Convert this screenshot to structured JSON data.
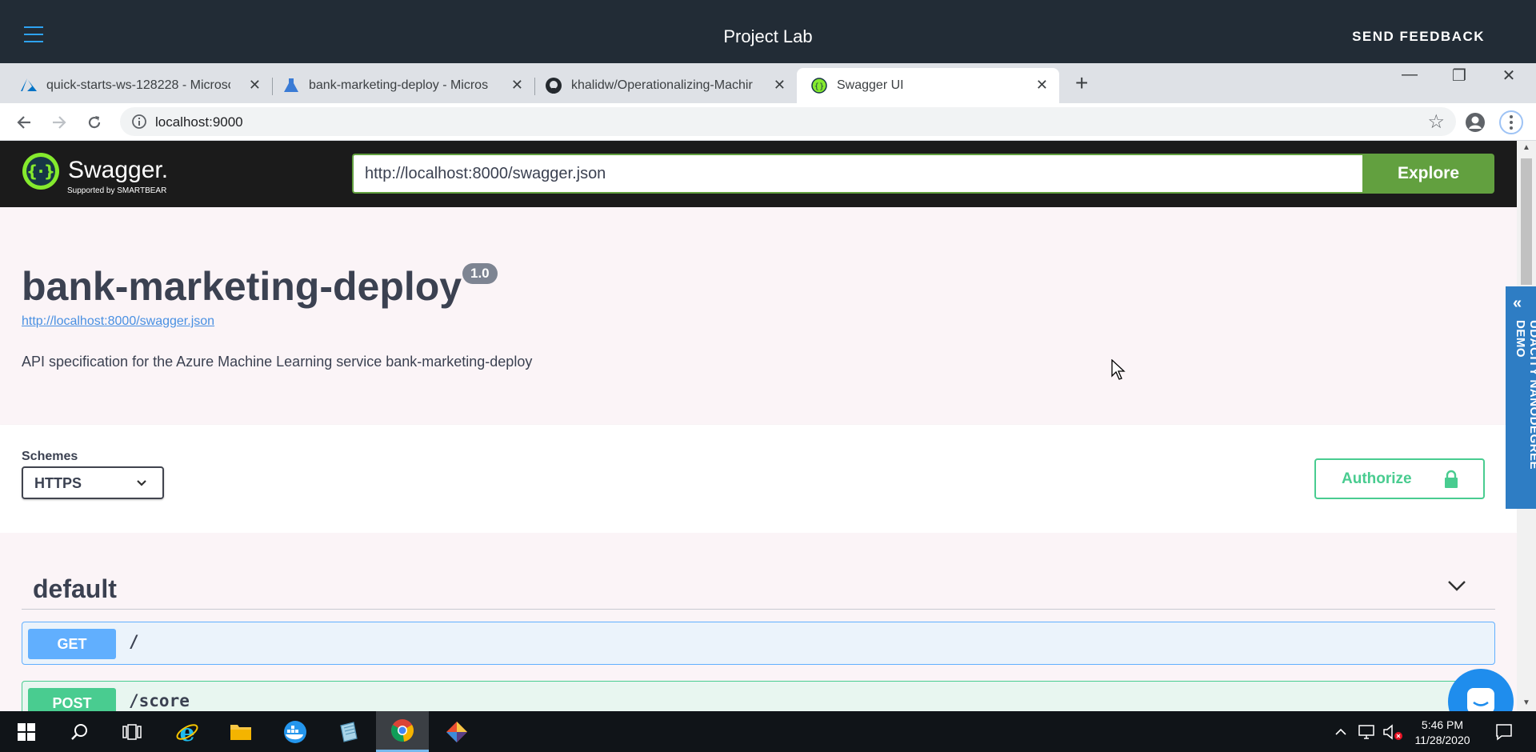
{
  "lab": {
    "title": "Project Lab",
    "feedback": "SEND FEEDBACK"
  },
  "browser": {
    "tabs": [
      {
        "title": "quick-starts-ws-128228 - Microso",
        "icon": "azure-icon"
      },
      {
        "title": "bank-marketing-deploy - Micros",
        "icon": "azure-ml-icon"
      },
      {
        "title": "khalidw/Operationalizing-Machir",
        "icon": "github-icon"
      },
      {
        "title": "Swagger UI",
        "icon": "swagger-icon"
      }
    ],
    "url": "localhost:9000"
  },
  "swagger": {
    "logo_text": "Swagger.",
    "logo_sub": "Supported by SMARTBEAR",
    "spec_url_value": "http://localhost:8000/swagger.json",
    "explore_label": "Explore",
    "api_title": "bank-marketing-deploy",
    "version": "1.0",
    "spec_link": "http://localhost:8000/swagger.json",
    "description": "API specification for the Azure Machine Learning service bank-marketing-deploy",
    "schemes_label": "Schemes",
    "scheme_selected": "HTTPS",
    "authorize_label": "Authorize",
    "tag": "default",
    "operations": [
      {
        "method": "GET",
        "path": "/"
      },
      {
        "method": "POST",
        "path": "/score"
      }
    ]
  },
  "side_tab": "UDACITY NANODEGREE DEMO",
  "taskbar": {
    "time": "5:46 PM",
    "date": "11/28/2020"
  },
  "colors": {
    "lab_header": "#222c36",
    "swagger_green": "#62a03f",
    "get_blue": "#61affe",
    "post_green": "#49cc90",
    "udacity_blue": "#2e7dc4"
  }
}
